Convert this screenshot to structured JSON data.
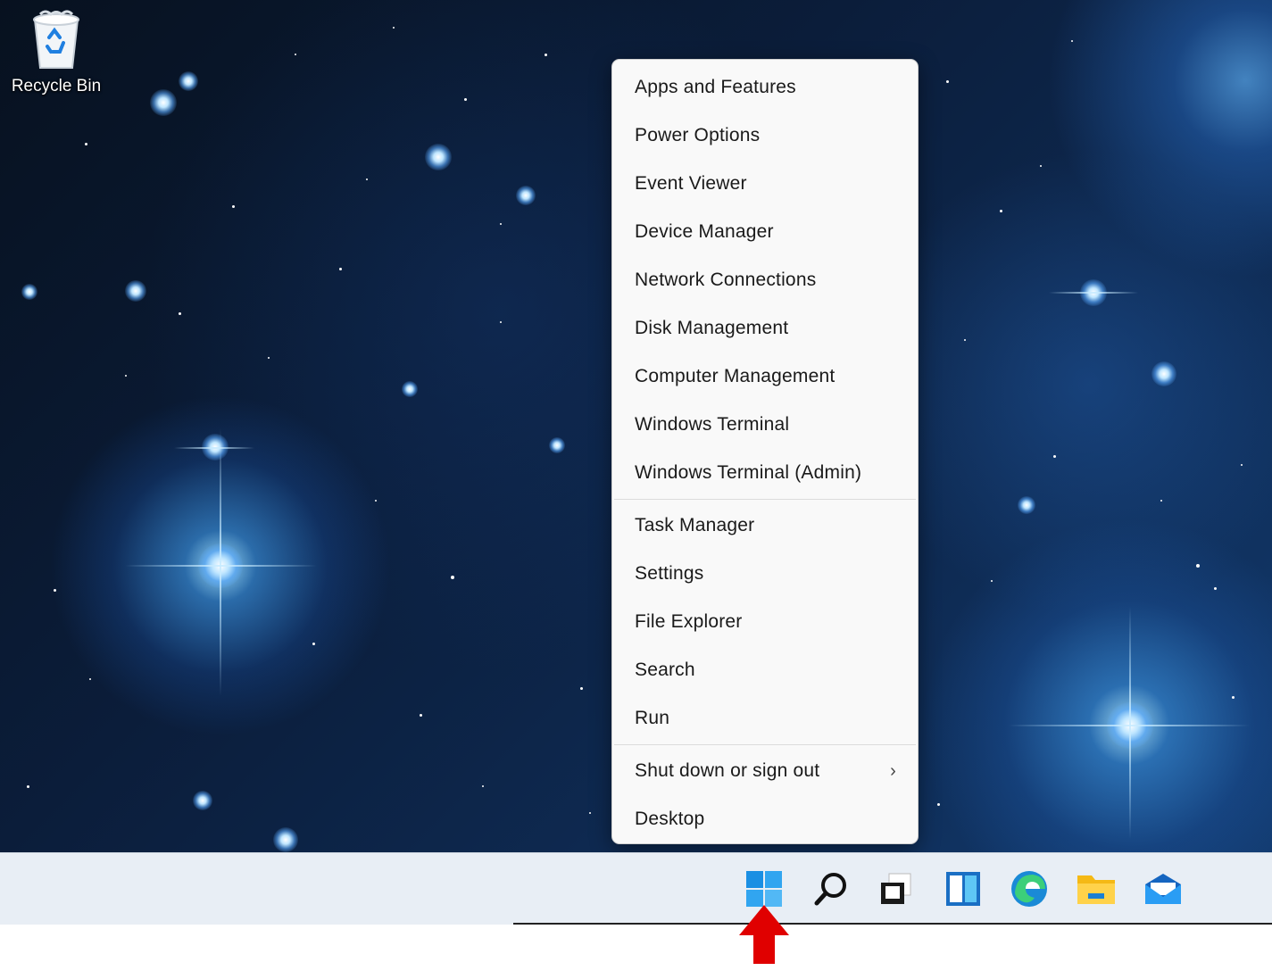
{
  "desktop": {
    "recycle_bin_label": "Recycle Bin"
  },
  "context_menu": {
    "group1": [
      "Apps and Features",
      "Power Options",
      "Event Viewer",
      "Device Manager",
      "Network Connections",
      "Disk Management",
      "Computer Management",
      "Windows Terminal",
      "Windows Terminal (Admin)"
    ],
    "group2": [
      "Task Manager",
      "Settings",
      "File Explorer",
      "Search",
      "Run"
    ],
    "group3": [
      "Shut down or sign out",
      "Desktop"
    ]
  },
  "taskbar": {
    "icons": [
      "windows-start-icon",
      "search-icon",
      "task-view-icon",
      "widgets-icon",
      "edge-icon",
      "file-explorer-icon",
      "mail-icon"
    ]
  },
  "colors": {
    "accent_blue": "#0078d4",
    "annotation_arrow": "#e00000",
    "menu_background": "#f9f9f9"
  }
}
